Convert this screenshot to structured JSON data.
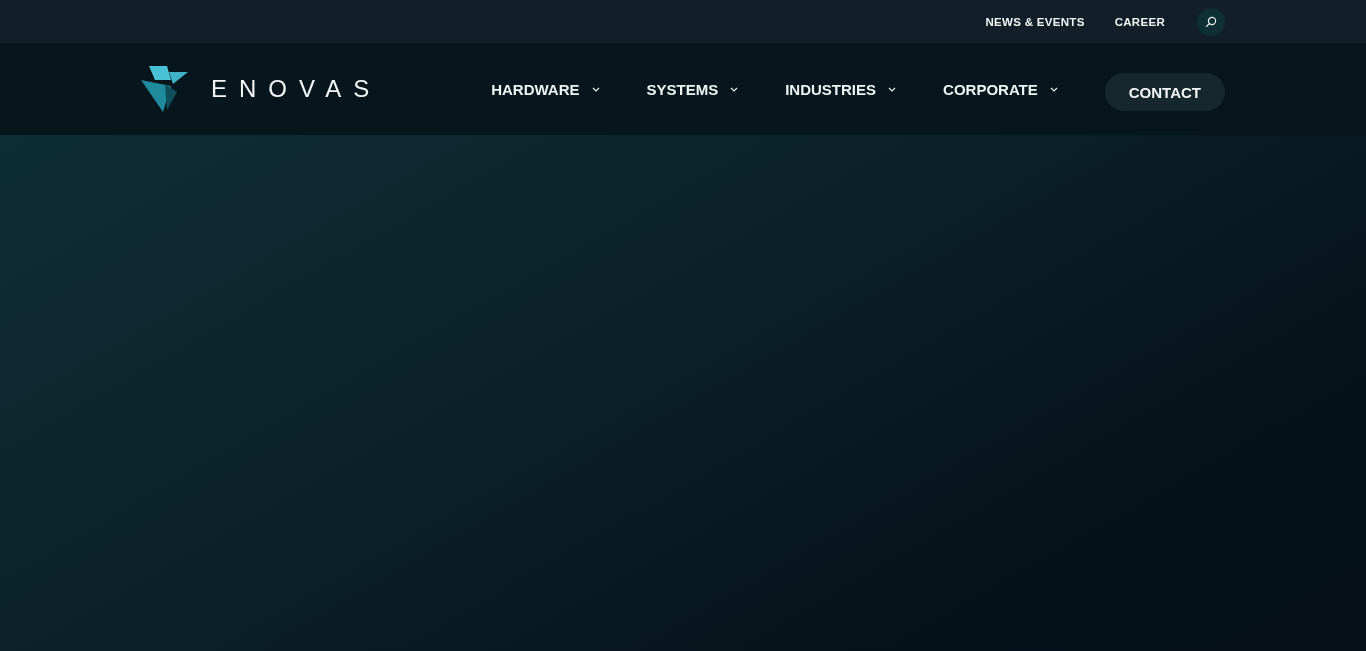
{
  "top_bar": {
    "links": [
      "NEWS & EVENTS",
      "CAREER"
    ]
  },
  "header": {
    "logo_text": "ENOVAS",
    "nav": [
      {
        "label": "HARDWARE",
        "has_dropdown": true
      },
      {
        "label": "SYSTEMS",
        "has_dropdown": true
      },
      {
        "label": "INDUSTRIES",
        "has_dropdown": true
      },
      {
        "label": "CORPORATE",
        "has_dropdown": true
      }
    ],
    "contact_button": "CONTACT"
  }
}
